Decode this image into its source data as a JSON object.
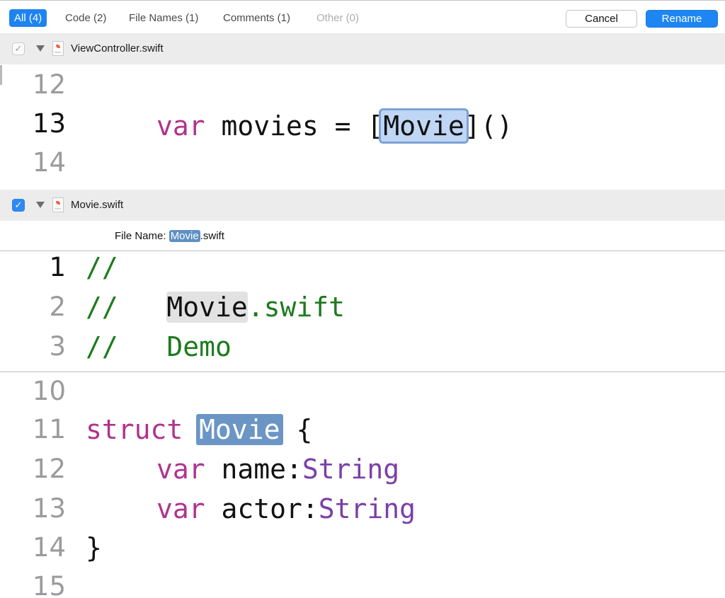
{
  "toolbar": {
    "tabs": [
      {
        "label": "All (4)"
      },
      {
        "label": "Code (2)"
      },
      {
        "label": "File Names (1)"
      },
      {
        "label": "Comments (1)"
      },
      {
        "label": "Other (0)"
      }
    ],
    "cancel_label": "Cancel",
    "rename_label": "Rename"
  },
  "files": [
    {
      "name": "ViewController.swift",
      "checked": false,
      "check_glyph": "✓",
      "icon_tag": "SWIFT"
    },
    {
      "name": "Movie.swift",
      "checked": true,
      "check_glyph": "✓",
      "icon_tag": "SWIFT"
    }
  ],
  "viewcontroller_code": [
    {
      "num": "12"
    },
    {
      "num": "13",
      "kw": "var",
      "text1": " movies = [",
      "match": "Movie",
      "text2": "]()"
    },
    {
      "num": "14"
    }
  ],
  "file_name_row": {
    "label": "File Name: ",
    "match": "Movie",
    "suffix": ".swift"
  },
  "movie_header": [
    {
      "num": "1",
      "comment": "//"
    },
    {
      "num": "2",
      "comment": "//   ",
      "match": "Movie",
      "rest": ".swift"
    },
    {
      "num": "3",
      "comment": "//   Demo"
    }
  ],
  "movie_body": [
    {
      "num": "10"
    },
    {
      "num": "11",
      "kw": "struct",
      "match": "Movie",
      "rest": " {"
    },
    {
      "num": "12",
      "kw": "var",
      "text": " name:",
      "type": "String"
    },
    {
      "num": "13",
      "kw": "var",
      "text": " actor:",
      "type": "String"
    },
    {
      "num": "14",
      "text": "}"
    },
    {
      "num": "15"
    }
  ],
  "colors": {
    "accent": "#1e83f1",
    "keyword": "#b0338d",
    "type": "#7b3fa8",
    "comment": "#1d7a1d",
    "match_highlight": "#6b95c5"
  }
}
